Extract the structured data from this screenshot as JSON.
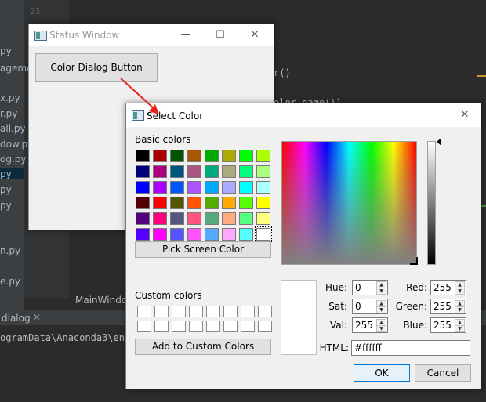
{
  "ide": {
    "line_number": "23",
    "project_items": [
      "py",
      "ageme",
      "x.py",
      "r.py",
      "all.py",
      "dow.py",
      "og.py",
      "py",
      "py",
      "py",
      "n.py",
      "e.py"
    ],
    "code_snippets": [
      "r()",
      "olor.name())"
    ],
    "main_window_label": "MainWindo",
    "run_tab": "dialog",
    "run_tab_close": "✕",
    "run_path": "ogramData\\Anaconda3\\env"
  },
  "status_window": {
    "title": "Status Window",
    "minimize": "—",
    "maximize": "☐",
    "close": "✕",
    "button_label": "Color Dialog Button"
  },
  "dialog": {
    "title": "Select Color",
    "close": "✕",
    "basic_colors_label": "Basic colors",
    "basic_colors": [
      [
        "#000000",
        "#aa0000",
        "#005500",
        "#aa5500",
        "#00aa00",
        "#aaaa00",
        "#00ff00",
        "#aaff00"
      ],
      [
        "#00007f",
        "#aa007f",
        "#00557f",
        "#aa557f",
        "#00aa7f",
        "#aaaa7f",
        "#00ff7f",
        "#aaff7f"
      ],
      [
        "#0000ff",
        "#aa00ff",
        "#0055ff",
        "#aa55ff",
        "#00aaff",
        "#aaaaff",
        "#00ffff",
        "#aaffff"
      ],
      [
        "#550000",
        "#ff0000",
        "#555500",
        "#ff5500",
        "#55aa00",
        "#ffaa00",
        "#55ff00",
        "#ffff00"
      ],
      [
        "#55007f",
        "#ff007f",
        "#55557f",
        "#ff557f",
        "#55aa7f",
        "#ffaa7f",
        "#55ff7f",
        "#ffff7f"
      ],
      [
        "#5500ff",
        "#ff00ff",
        "#5555ff",
        "#ff55ff",
        "#55aaff",
        "#ffaaff",
        "#55ffff",
        "#ffffff"
      ]
    ],
    "pick_screen_label": "Pick Screen Color",
    "custom_colors_label": "Custom colors",
    "add_custom_label": "Add to Custom Colors",
    "hue_label": "Hue:",
    "hue": "0",
    "sat_label": "Sat:",
    "sat": "0",
    "val_label": "Val:",
    "val": "255",
    "red_label": "Red:",
    "red": "255",
    "green_label": "Green:",
    "green": "255",
    "blue_label": "Blue:",
    "blue": "255",
    "html_label": "HTML:",
    "html_value": "#ffffff",
    "ok_label": "OK",
    "cancel_label": "Cancel",
    "spin_up": "▲",
    "spin_down": "▼"
  },
  "annotation": {
    "arrow_color": "#e8211b"
  }
}
